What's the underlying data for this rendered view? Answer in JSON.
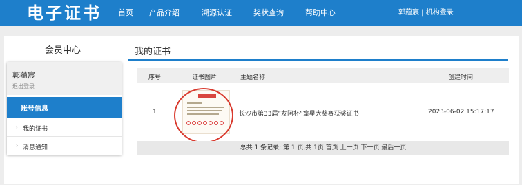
{
  "header": {
    "logo": "电子证书",
    "nav": [
      "首页",
      "产品介绍",
      "溯源认证",
      "奖状查询",
      "帮助中心"
    ],
    "user_link": "郭蕴宸 | 机构登录"
  },
  "sidebar": {
    "title": "会员中心",
    "username": "郭蕴宸",
    "logout": "退出登录",
    "active_item": "账号信息",
    "items": [
      {
        "label": "我的证书"
      },
      {
        "label": "消息通知"
      }
    ]
  },
  "main": {
    "title": "我的证书",
    "table": {
      "headers": [
        "序号",
        "证书图片",
        "主题名称",
        "创建时间"
      ],
      "rows": [
        {
          "index": "1",
          "name": "长沙市第33届“友阿杯”童星大奖赛获奖证书",
          "created": "2023-06-02 15:17:17"
        }
      ]
    },
    "pagination": "总共 1 条记录; 第 1 页,共 1页 首页 上一页 下一页 最后一页"
  },
  "colors": {
    "accent": "#1e7fcb",
    "highlight_ring": "#d93a2e"
  }
}
